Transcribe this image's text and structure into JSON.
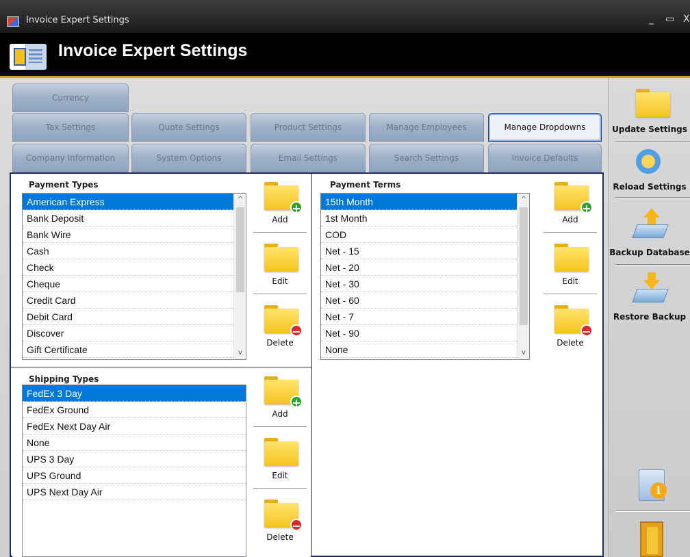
{
  "window": {
    "title": "Invoice Expert Settings",
    "minimize": "_",
    "maximize": "▭",
    "close": "X"
  },
  "header": {
    "title": "Invoice Expert Settings"
  },
  "tabs": {
    "row1": [
      "Currency"
    ],
    "row2": [
      "Tax Settings",
      "Quote Settings",
      "Product Settings",
      "Manage Employees",
      "Manage Dropdowns"
    ],
    "row3": [
      "Company Information",
      "System Options",
      "Email Settings",
      "Search Settings",
      "Invoice Defaults"
    ],
    "active": "Manage Dropdowns"
  },
  "payment_types": {
    "title": "Payment Types",
    "items": [
      "American Express",
      "Bank Deposit",
      "Bank Wire",
      "Cash",
      "Check",
      "Cheque",
      "Credit Card",
      "Debit Card",
      "Discover",
      "Gift Certificate"
    ],
    "selected": "American Express"
  },
  "payment_terms": {
    "title": "Payment Terms",
    "items": [
      "15th Month",
      "1st Month",
      "COD",
      "Net - 15",
      "Net - 20",
      "Net - 30",
      "Net - 60",
      "Net - 7",
      "Net - 90",
      "None"
    ],
    "selected": "15th Month"
  },
  "shipping_types": {
    "title": "Shipping Types",
    "items": [
      "FedEx 3 Day",
      "FedEx Ground",
      "FedEx Next Day Air",
      "None",
      "UPS 3 Day",
      "UPS Ground",
      "UPS Next Day Air"
    ],
    "selected": "FedEx 3 Day"
  },
  "actions": {
    "add": "Add",
    "edit": "Edit",
    "delete": "Delete"
  },
  "sidebar": {
    "update": "Update Settings",
    "reload": "Reload Settings",
    "backup": "Backup Database",
    "restore": "Restore Backup"
  }
}
